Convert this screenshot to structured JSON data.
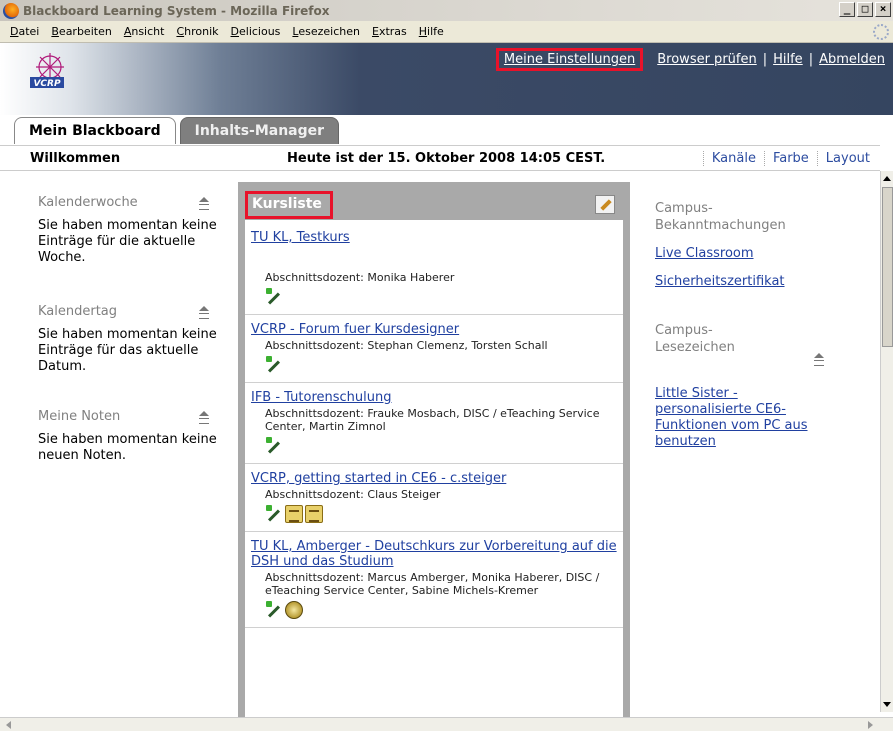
{
  "window": {
    "title": "Blackboard Learning System - Mozilla Firefox",
    "buttons": [
      "_",
      "□",
      "×"
    ]
  },
  "menubar": [
    "Datei",
    "Bearbeiten",
    "Ansicht",
    "Chronik",
    "Delicious",
    "Lesezeichen",
    "Extras",
    "Hilfe"
  ],
  "header": {
    "logo_text": "VCRP",
    "links": {
      "settings": "Meine Einstellungen",
      "browser": "Browser prüfen",
      "help": "Hilfe",
      "logout": "Abmelden"
    },
    "separator": "|",
    "tabs": [
      "Mein Blackboard",
      "Inhalts-Manager"
    ]
  },
  "welcomebar": {
    "welcome": "Willkommen",
    "date": "Heute ist der 15. Oktober 2008 14:05 CEST.",
    "options": [
      "Kanäle",
      "Farbe",
      "Layout"
    ]
  },
  "left": {
    "modules": [
      {
        "title": "Kalenderwoche",
        "body": "Sie haben momentan keine Einträge für die aktuelle Woche."
      },
      {
        "title": "Kalendertag",
        "body": "Sie haben momentan keine Einträge für das aktuelle Datum."
      },
      {
        "title": "Meine Noten",
        "body": "Sie haben momentan keine neuen Noten."
      }
    ]
  },
  "courselist": {
    "title": "Kursliste",
    "courses": [
      {
        "name": "TU KL, Testkurs",
        "instructor": "Abschnittsdozent: Monika Haberer"
      },
      {
        "name": "VCRP - Forum fuer Kursdesigner",
        "instructor": "Abschnittsdozent: Stephan Clemenz, Torsten Schall"
      },
      {
        "name": "IFB - Tutorenschulung",
        "instructor": "Abschnittsdozent: Frauke Mosbach, DISC / eTeaching Service Center, Martin Zimnol"
      },
      {
        "name": "VCRP, getting started in CE6 - c.steiger",
        "instructor": "Abschnittsdozent: Claus Steiger"
      },
      {
        "name": "TU KL, Amberger - Deutschkurs zur Vorbereitung auf die DSH und das Studium",
        "instructor": "Abschnittsdozent: Marcus Amberger, Monika Haberer, DISC / eTeaching Service Center, Sabine Michels-Kremer"
      }
    ]
  },
  "right": {
    "announcements_title": "Campus-Bekanntmachungen",
    "announcements": [
      "Live Classroom",
      "Sicherheitszertifikat"
    ],
    "bookmarks_title": "Campus-Lesezeichen",
    "bookmarks": [
      "Little Sister - personalisierte CE6-Funktionen vom PC aus benutzen"
    ]
  },
  "colors": {
    "highlight": "#e8122a",
    "link": "#2040a0",
    "header_dark": "#354560"
  }
}
